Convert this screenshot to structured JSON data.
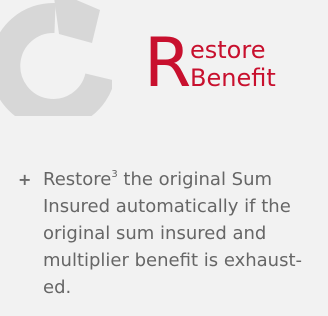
{
  "heading": {
    "initial": "R",
    "line1": "estore",
    "line2": "Benefit"
  },
  "bullet": {
    "marker": "+",
    "text_before_sup": "Restore",
    "superscript": "3",
    "text_after_sup": " the original Sum Insured automatically if the original sum insured and multiplier benefit is exhaust-ed."
  },
  "colors": {
    "background": "#f2f2f2",
    "accent_red": "#c8102e",
    "body_text": "#666666",
    "icon_gray": "#d7d7d7"
  },
  "icon": {
    "name": "restore-arrow-icon"
  }
}
